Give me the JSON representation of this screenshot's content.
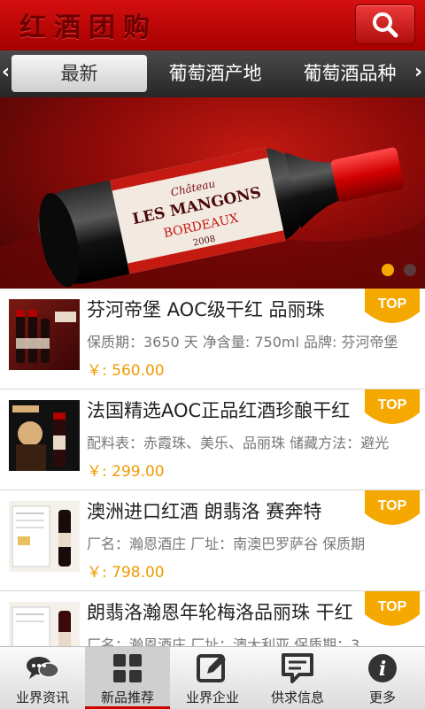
{
  "header": {
    "title": "红酒团购",
    "search_icon": "search-icon"
  },
  "tabs": {
    "left_arrow": "‹",
    "right_arrow": "›",
    "items": [
      {
        "label": "最新"
      },
      {
        "label": "葡萄酒产地"
      },
      {
        "label": "葡萄酒品种"
      }
    ]
  },
  "banner": {
    "label_line1": "Château",
    "label_line2": "LES MANGONS",
    "label_line3": "BORDEAUX",
    "vintage": "2008",
    "active_slide": 1,
    "total_slides": 2
  },
  "products": [
    {
      "title": "芬河帝堡 AOC级干红 品丽珠",
      "desc": "保质期：3650 天 净含量: 750ml 品牌: 芬河帝堡",
      "price": "￥: 560.00",
      "badge": "TOP"
    },
    {
      "title": "法国精选AOC正品红酒珍酿干红",
      "desc": "配料表：赤霞珠、美乐、品丽珠 储藏方法：避光",
      "price": "￥: 299.00",
      "badge": "TOP"
    },
    {
      "title": "澳洲进口红酒 朗翡洛 赛奔特",
      "desc": "厂名：瀚恩酒庄 厂址：南澳巴罗萨谷 保质期",
      "price": "￥: 798.00",
      "badge": "TOP"
    },
    {
      "title": "朗翡洛瀚恩年轮梅洛品丽珠 干红",
      "desc": "厂名：瀚恩酒庄 厂址：澳大利亚 保质期：3",
      "price": "",
      "badge": "TOP"
    }
  ],
  "bottom_nav": [
    {
      "label": "业界资讯",
      "icon": "chat-bubbles-icon"
    },
    {
      "label": "新品推荐",
      "icon": "grid-icon"
    },
    {
      "label": "业界企业",
      "icon": "edit-icon"
    },
    {
      "label": "供求信息",
      "icon": "message-icon"
    },
    {
      "label": "更多",
      "icon": "info-icon"
    }
  ],
  "colors": {
    "header": "#c0100d",
    "price": "#f09a00",
    "badge": "#f5a800"
  }
}
